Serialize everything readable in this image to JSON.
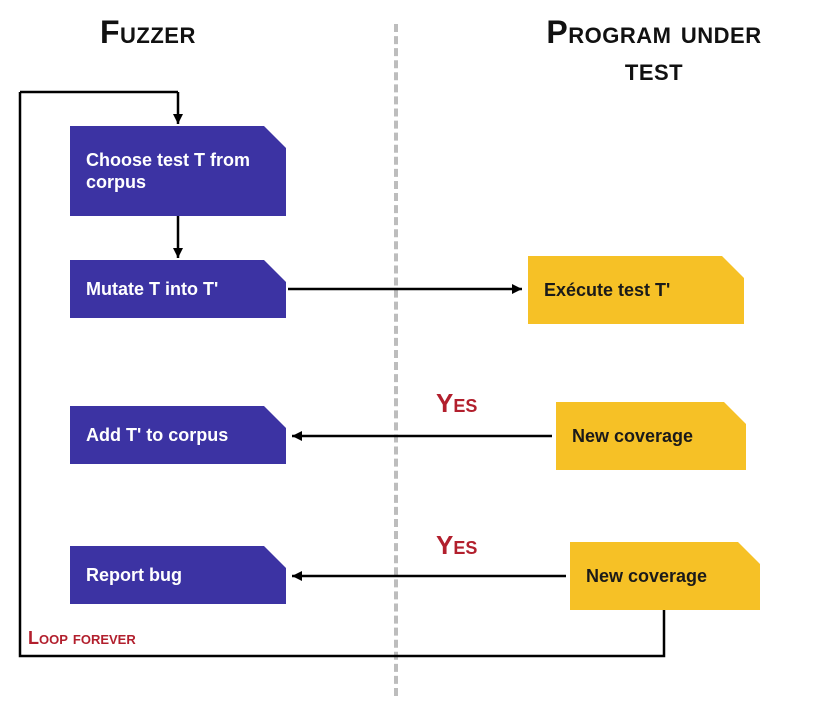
{
  "titles": {
    "left": "Fuzzer",
    "right": "Program under test"
  },
  "boxes": {
    "choose": "Choose test T from corpus",
    "mutate": "Mutate T into T'",
    "execute": "Exécute test T'",
    "add": "Add T' to corpus",
    "coverage1": "New coverage",
    "report": "Report bug",
    "coverage2": "New coverage"
  },
  "labels": {
    "yes1": "Yes",
    "yes2": "Yes",
    "loop": "Loop forever"
  }
}
